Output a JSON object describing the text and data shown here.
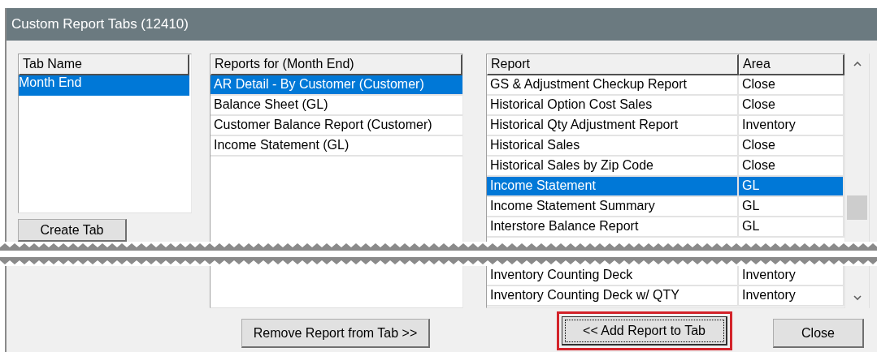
{
  "window": {
    "title": "Custom Report Tabs (12410)"
  },
  "tab_list": {
    "columns": [
      "Tab Name"
    ],
    "rows": [
      {
        "cells": [
          "Month End"
        ],
        "selected": true
      }
    ]
  },
  "create_tab_button": {
    "label": "Create Tab"
  },
  "tab_reports": {
    "columns": [
      "Reports for (Month End)"
    ],
    "rows": [
      {
        "cells": [
          "AR Detail - By Customer (Customer)"
        ],
        "selected": true
      },
      {
        "cells": [
          "Balance Sheet (GL)"
        ],
        "selected": false
      },
      {
        "cells": [
          "Customer Balance Report (Customer)"
        ],
        "selected": false
      },
      {
        "cells": [
          "Income Statement (GL)"
        ],
        "selected": false
      }
    ]
  },
  "available_reports": {
    "columns": [
      "Report",
      "Area"
    ],
    "rows": [
      {
        "cells": [
          "GS & Adjustment Checkup Report",
          "Close"
        ],
        "selected": false
      },
      {
        "cells": [
          "Historical Option Cost Sales",
          "Close"
        ],
        "selected": false
      },
      {
        "cells": [
          "Historical Qty Adjustment Report",
          "Inventory"
        ],
        "selected": false
      },
      {
        "cells": [
          "Historical Sales",
          "Close"
        ],
        "selected": false
      },
      {
        "cells": [
          "Historical Sales by Zip Code",
          "Close"
        ],
        "selected": false
      },
      {
        "cells": [
          "Income Statement",
          "GL"
        ],
        "selected": true
      },
      {
        "cells": [
          "Income Statement Summary",
          "GL"
        ],
        "selected": false
      },
      {
        "cells": [
          "Interstore Balance Report",
          "GL"
        ],
        "selected": false
      }
    ],
    "rows_after_break": [
      {
        "cells": [
          "Inventory Counting Deck",
          "Inventory"
        ],
        "selected": false
      },
      {
        "cells": [
          "Inventory Counting Deck w/ QTY",
          "Inventory"
        ],
        "selected": false
      }
    ]
  },
  "buttons": [
    {
      "label": "Remove Report from Tab >>",
      "focused": false,
      "highlighted": false
    },
    {
      "label": "<< Add Report to Tab",
      "focused": true,
      "highlighted": true
    },
    {
      "label": "Close",
      "focused": false,
      "highlighted": false
    }
  ]
}
